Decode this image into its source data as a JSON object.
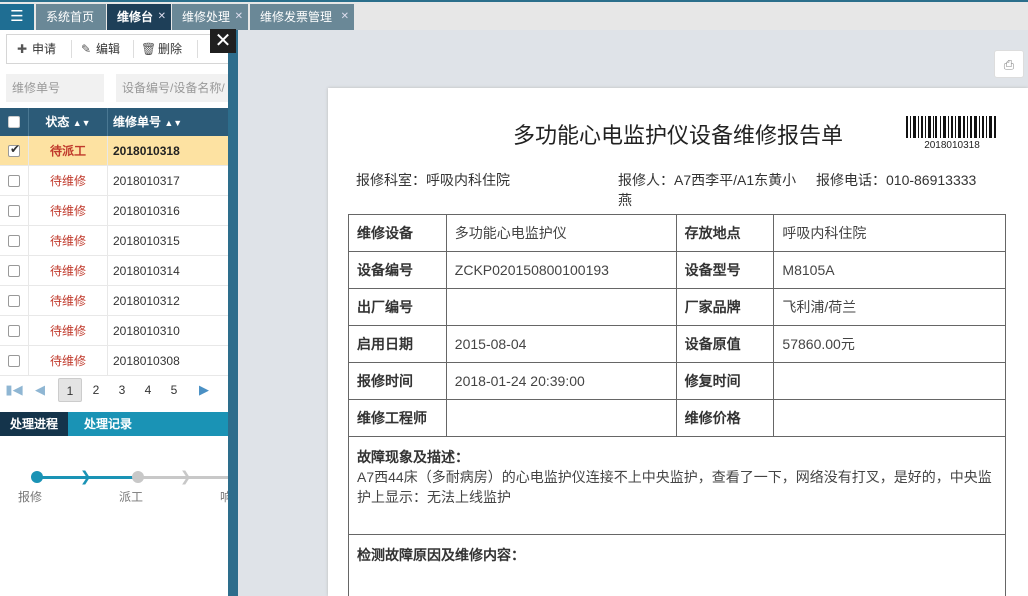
{
  "tabs": [
    {
      "label": "系统首页",
      "closable": false
    },
    {
      "label": "维修台",
      "closable": true,
      "active": true
    },
    {
      "label": "维修处理",
      "closable": true
    },
    {
      "label": "维修发票管理",
      "closable": true
    }
  ],
  "toolbar": {
    "apply": "申请",
    "edit": "编辑",
    "delete": "删除"
  },
  "search": {
    "repair_no_placeholder": "维修单号",
    "device_placeholder": "设备编号/设备名称/"
  },
  "table": {
    "headers": {
      "status": "状态",
      "repair_no": "维修单号"
    },
    "rows": [
      {
        "status": "待派工",
        "no": "2018010318",
        "selected": true
      },
      {
        "status": "待维修",
        "no": "2018010317"
      },
      {
        "status": "待维修",
        "no": "2018010316"
      },
      {
        "status": "待维修",
        "no": "2018010315"
      },
      {
        "status": "待维修",
        "no": "2018010314"
      },
      {
        "status": "待维修",
        "no": "2018010312"
      },
      {
        "status": "待维修",
        "no": "2018010310"
      },
      {
        "status": "待维修",
        "no": "2018010308"
      }
    ]
  },
  "pager": {
    "pages": [
      "1",
      "2",
      "3",
      "4",
      "5"
    ],
    "current": "1"
  },
  "process": {
    "tabs": [
      "处理进程",
      "处理记录"
    ],
    "steps": [
      "报修",
      "派工",
      "响"
    ]
  },
  "report": {
    "title": "多功能心电监护仪设备维修报告单",
    "barcode_no": "2018010318",
    "dept": "报修科室：呼吸内科住院",
    "reporter": "报修人：A7西李平/A1东黄小燕",
    "phone": "报修电话：010-86913333",
    "fields": {
      "device_label": "维修设备",
      "device": "多功能心电监护仪",
      "location_label": "存放地点",
      "location": "呼吸内科住院",
      "device_no_label": "设备编号",
      "device_no": "ZCKP020150800100193",
      "model_label": "设备型号",
      "model": "M8105A",
      "factory_no_label": "出厂编号",
      "factory_no": "",
      "brand_label": "厂家品牌",
      "brand": "飞利浦/荷兰",
      "start_date_label": "启用日期",
      "start_date": "2015-08-04",
      "value_label": "设备原值",
      "value": "57860.00元",
      "report_time_label": "报修时间",
      "report_time": "2018-01-24 20:39:00",
      "fix_time_label": "修复时间",
      "fix_time": "",
      "engineer_label": "维修工程师",
      "engineer": "",
      "price_label": "维修价格",
      "price": "",
      "fault_label": "故障现象及描述：",
      "fault": "A7西44床（多耐病房）的心电监护仪连接不上中央监护，查看了一下，网络没有打叉，是好的，中央监护上显示：无法上线监护",
      "cause_label": "检测故障原因及维修内容："
    }
  }
}
